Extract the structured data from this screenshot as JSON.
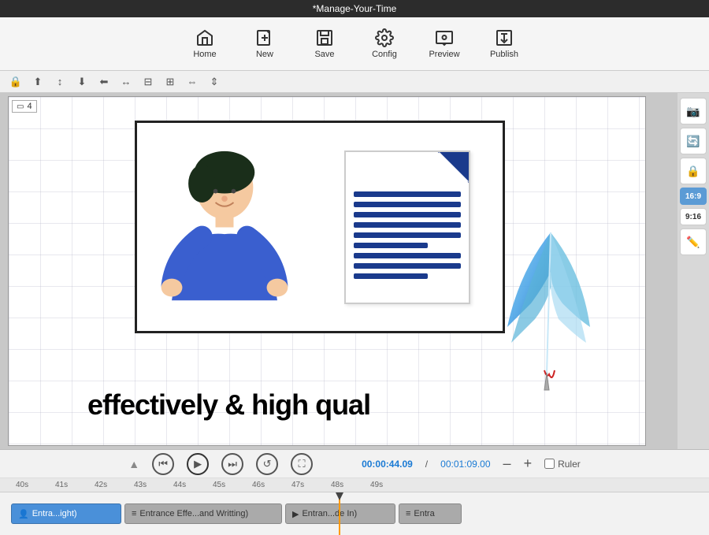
{
  "titleBar": {
    "title": "*Manage-Your-Time"
  },
  "toolbar": {
    "items": [
      {
        "id": "home",
        "label": "Home",
        "icon": "home"
      },
      {
        "id": "new",
        "label": "New",
        "icon": "new"
      },
      {
        "id": "save",
        "label": "Save",
        "icon": "save"
      },
      {
        "id": "config",
        "label": "Config",
        "icon": "config"
      },
      {
        "id": "preview",
        "label": "Preview",
        "icon": "preview"
      },
      {
        "id": "publish",
        "label": "Publish",
        "icon": "publish"
      }
    ]
  },
  "canvas": {
    "label": "4"
  },
  "timeline": {
    "currentTime": "00:00:44.09",
    "totalTime": "00:01:09.00",
    "rulerMarks": [
      "40s",
      "41s",
      "42s",
      "43s",
      "44s",
      "45s",
      "46s",
      "47s",
      "48s",
      "49s"
    ],
    "tracks": [
      {
        "id": "t1",
        "label": "Entra...ight)",
        "type": "blue",
        "icon": "person"
      },
      {
        "id": "t2",
        "label": "Entrance Effe...and Writting)",
        "type": "gray",
        "icon": "lines"
      },
      {
        "id": "t3",
        "label": "Entran...de In)",
        "type": "gray",
        "icon": "triangle"
      },
      {
        "id": "t4",
        "label": "Entra",
        "type": "gray",
        "icon": "lines"
      }
    ]
  },
  "textOverlay": "effectively & high qual",
  "rightPanel": {
    "aspectRatios": [
      "16:9",
      "9:16"
    ],
    "activeRatio": "16:9"
  }
}
